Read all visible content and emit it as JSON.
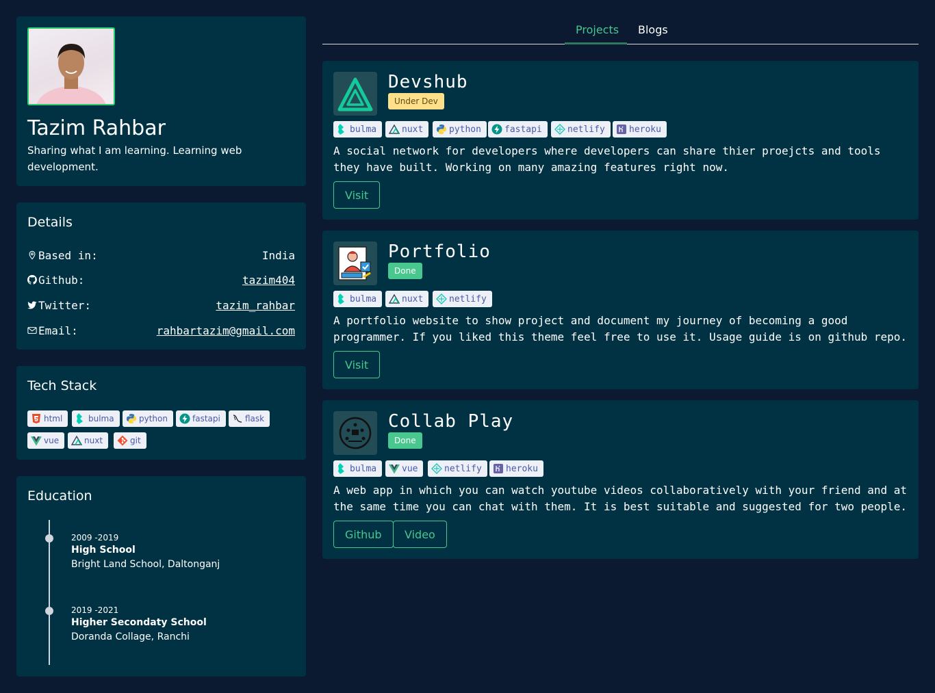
{
  "profile": {
    "name": "Tazim Rahbar",
    "bio": "Sharing what I am learning. Learning web development."
  },
  "details": {
    "title": "Details",
    "rows": [
      {
        "label": "Based in:",
        "value": "India",
        "icon": "location-pin-icon"
      },
      {
        "label": "Github:",
        "value": "tazim404",
        "icon": "github-icon"
      },
      {
        "label": "Twitter:",
        "value": "tazim_rahbar",
        "icon": "twitter-icon"
      },
      {
        "label": "Email:",
        "value": "rahbartazim@gmail.com",
        "icon": "mail-icon"
      }
    ]
  },
  "tech_stack": {
    "title": "Tech Stack",
    "tags": [
      "html",
      "bulma",
      "python",
      "fastapi",
      "flask",
      "vue",
      "nuxt",
      "git"
    ]
  },
  "education": {
    "title": "Education",
    "items": [
      {
        "years": "2009 -2019",
        "degree": "High School",
        "school": "Bright Land School, Daltonganj"
      },
      {
        "years": "2019 -2021",
        "degree": "Higher Secondaty School",
        "school": "Doranda Collage, Ranchi"
      }
    ]
  },
  "tabs": {
    "projects": "Projects",
    "blogs": "Blogs"
  },
  "projects": [
    {
      "title": "Devshub",
      "status": "Under Dev",
      "tags": [
        "bulma",
        "nuxt",
        "python",
        "fastapi",
        "netlify",
        "heroku"
      ],
      "description": "A social network for developers where developers can share thier proejcts and tools they have built. Working on many amazing features right now.",
      "buttons": [
        "Visit"
      ]
    },
    {
      "title": "Portfolio",
      "status": "Done",
      "tags": [
        "bulma",
        "nuxt",
        "netlify"
      ],
      "description": "A portfolio website to show project and document my journey of becoming a good programmer. If you liked this theme feel free to use it. Usage guide is on github repo.",
      "buttons": [
        "Visit"
      ]
    },
    {
      "title": "Collab Play",
      "status": "Done",
      "tags": [
        "bulma",
        "vue",
        "netlify",
        "heroku"
      ],
      "description": "A web app in which you can watch youtube videos collaboratively with your friend and at the same time you can chat with them. It is best suitable and suggested for two people.",
      "buttons": [
        "Github",
        "Video"
      ]
    }
  ],
  "colors": {
    "background": "#0b1a30",
    "card": "#013243",
    "accent": "#48c78e",
    "warning": "#ffe08a"
  }
}
